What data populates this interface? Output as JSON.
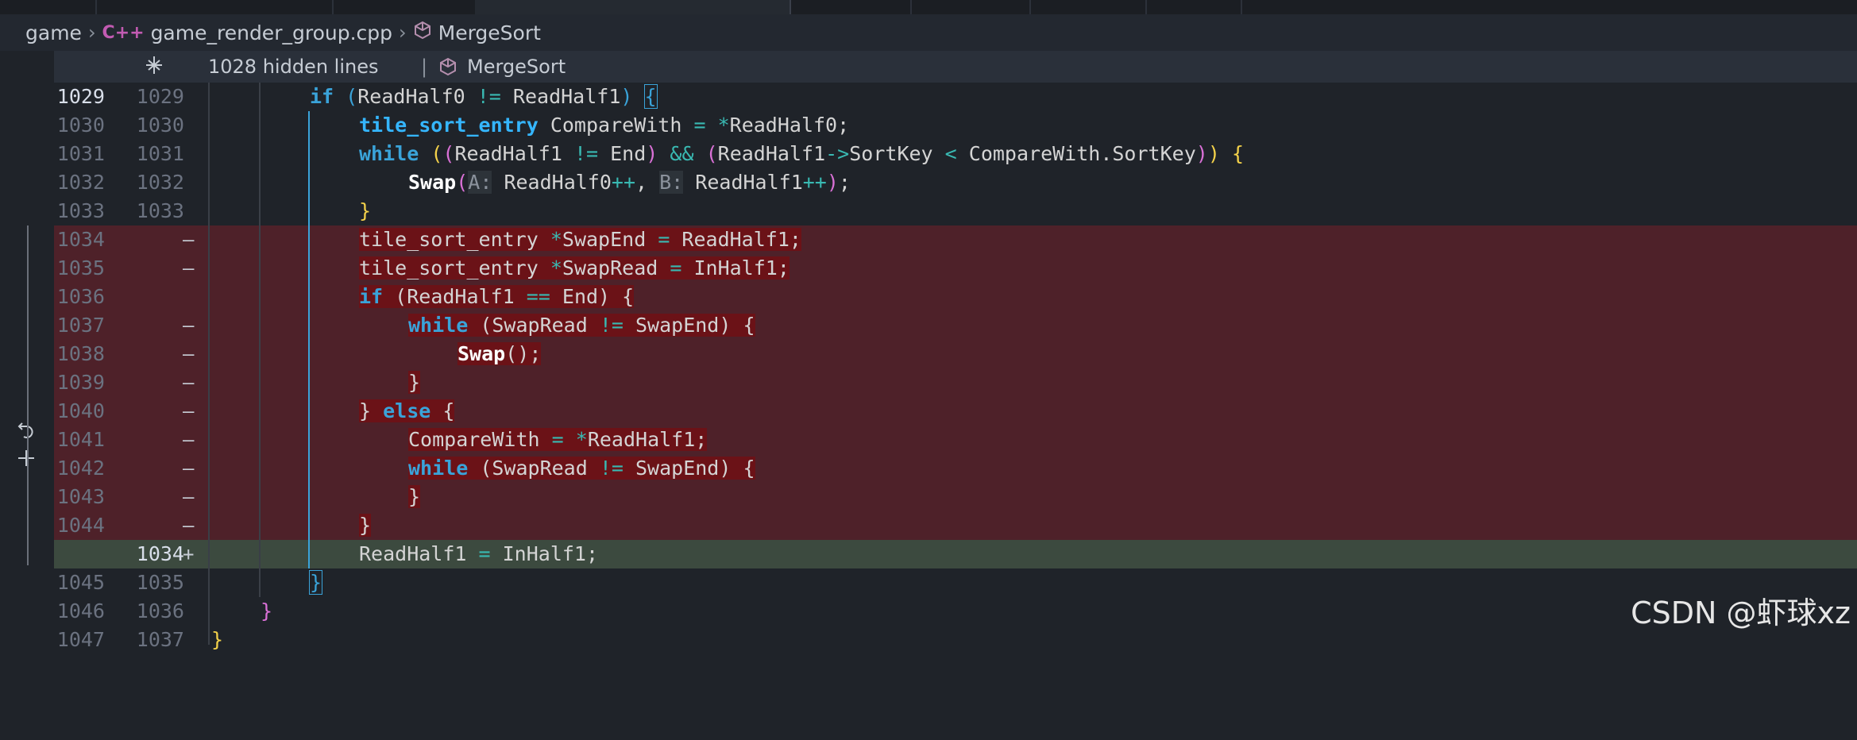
{
  "breadcrumb": {
    "folder": "game",
    "file": "game_render_group.cpp",
    "symbol": "MergeSort"
  },
  "sticky": {
    "hidden": "1028 hidden lines",
    "divider": "|",
    "scope": "MergeSort"
  },
  "diff_marks": {
    "remove": "—",
    "add": "+"
  },
  "watermark": "CSDN @虾球xz",
  "icons": {
    "file_type": "c++-file-icon",
    "symbol": "cube-icon",
    "unfold": "unfold-icon",
    "lightbulb": "lightbulb-icon",
    "revert": "revert-icon",
    "add": "add-icon"
  },
  "lines": [
    {
      "n1": "1029",
      "n2": "1029",
      "t": "if (ReadHalf0 != ReadHalf1) {"
    },
    {
      "n1": "1030",
      "n2": "1030",
      "t": "tile_sort_entry CompareWith = *ReadHalf0;"
    },
    {
      "n1": "1031",
      "n2": "1031",
      "t": "while ((ReadHalf1 != End) && (ReadHalf1->SortKey < CompareWith.SortKey)) {"
    },
    {
      "n1": "1032",
      "n2": "1032",
      "t": "Swap(A: ReadHalf0++, B: ReadHalf1++);"
    },
    {
      "n1": "1033",
      "n2": "1033",
      "t": "}"
    },
    {
      "n1": "1034",
      "n2": "",
      "t": "tile_sort_entry *SwapEnd = ReadHalf1;"
    },
    {
      "n1": "1035",
      "n2": "",
      "t": "tile_sort_entry *SwapRead = InHalf1;"
    },
    {
      "n1": "1036",
      "n2": "",
      "t": "if (ReadHalf1 == End) {"
    },
    {
      "n1": "1037",
      "n2": "",
      "t": "while (SwapRead != SwapEnd) {"
    },
    {
      "n1": "1038",
      "n2": "",
      "t": "Swap();"
    },
    {
      "n1": "1039",
      "n2": "",
      "t": "}"
    },
    {
      "n1": "1040",
      "n2": "",
      "t": "} else {"
    },
    {
      "n1": "1041",
      "n2": "",
      "t": "CompareWith = *ReadHalf1;"
    },
    {
      "n1": "1042",
      "n2": "",
      "t": "while (SwapRead != SwapEnd) {"
    },
    {
      "n1": "1043",
      "n2": "",
      "t": "}"
    },
    {
      "n1": "1044",
      "n2": "",
      "t": "}"
    },
    {
      "n1": "",
      "n2": "1034",
      "t": "ReadHalf1 = InHalf1;"
    },
    {
      "n1": "1045",
      "n2": "1035",
      "t": "}"
    },
    {
      "n1": "1046",
      "n2": "1036",
      "t": "}"
    },
    {
      "n1": "1047",
      "n2": "1037",
      "t": "}"
    }
  ]
}
